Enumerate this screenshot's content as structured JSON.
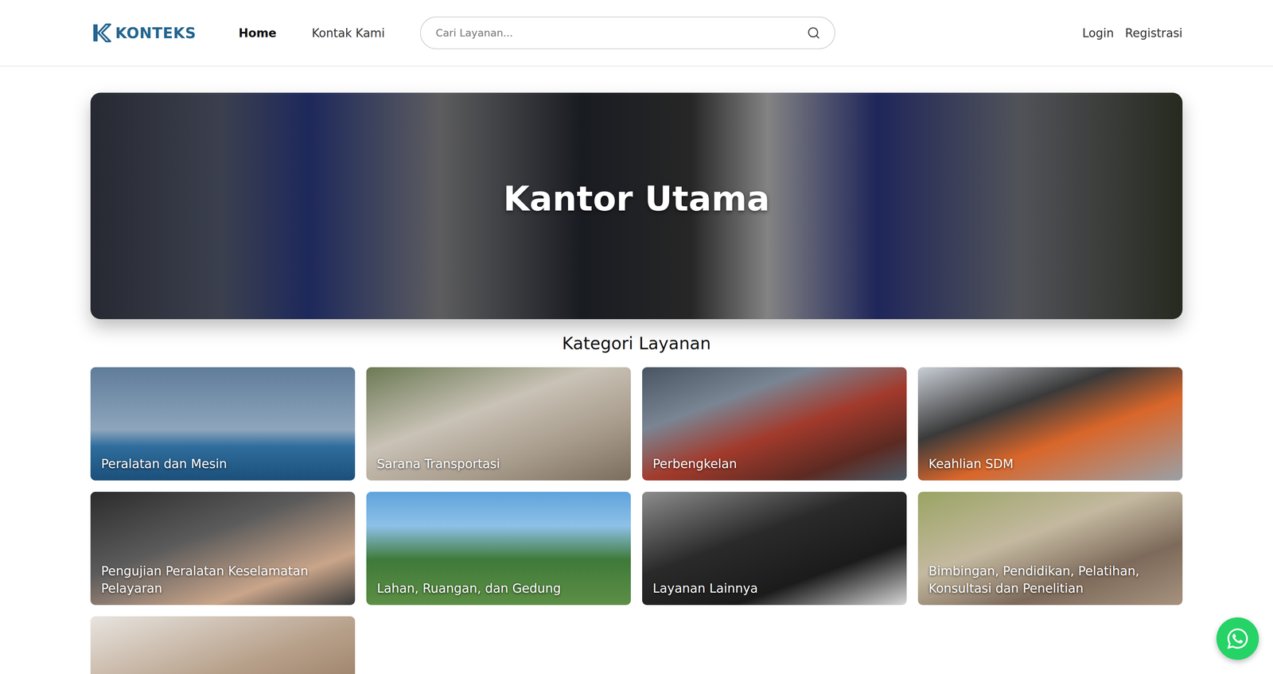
{
  "header": {
    "logo": "KONTEKS",
    "nav": [
      {
        "label": "Home",
        "selected": true
      },
      {
        "label": "Kontak Kami",
        "selected": false
      }
    ],
    "search": {
      "placeholder": "Cari Layanan..."
    },
    "auth": [
      "Login",
      "Registrasi"
    ]
  },
  "hero": {
    "title": "Kantor Utama"
  },
  "section": {
    "title": "Kategori Layanan"
  },
  "categories": [
    {
      "label": "Peralatan dan Mesin"
    },
    {
      "label": "Sarana Transportasi"
    },
    {
      "label": "Perbengkelan"
    },
    {
      "label": "Keahlian SDM"
    },
    {
      "label": "Pengujian Peralatan Keselamatan Pelayaran"
    },
    {
      "label": "Lahan, Ruangan, dan Gedung"
    },
    {
      "label": "Layanan Lainnya"
    },
    {
      "label": "Bimbingan, Pendidikan, Pelatihan, Konsultasi dan Penelitian"
    },
    {
      "label": ""
    }
  ]
}
